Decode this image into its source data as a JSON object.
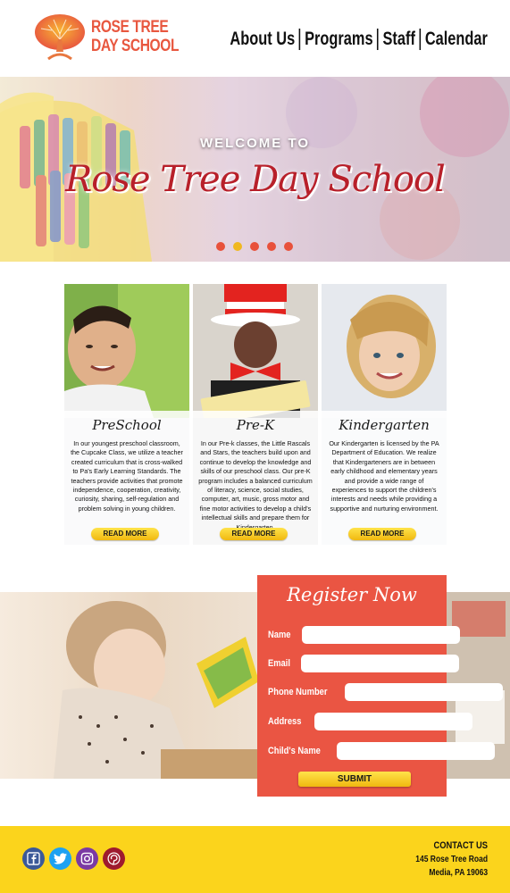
{
  "brand": {
    "line1": "ROSE TREE",
    "line2": "DAY SCHOOL",
    "color": "#e8573f"
  },
  "nav": {
    "items": [
      "About Us",
      "Programs",
      "Staff",
      "Calendar"
    ]
  },
  "hero": {
    "welcome": "WELCOME TO",
    "title": "Rose Tree Day School",
    "slides": 5,
    "active_slide": 2
  },
  "programs": [
    {
      "title": "PreSchool",
      "body": "In our youngest preschool classroom, the Cupcake Class, we utilize a teacher created curriculum that is cross-walked to Pa's Early Learning Standards. The teachers provide activities that promote independence, cooperation, creativity, curiosity, sharing, self-regulation and problem solving in young children.",
      "button": "READ MORE"
    },
    {
      "title": "Pre-K",
      "body": "In our Pre-k classes, the Little Rascals and Stars, the teachers build upon and continue to develop the knowledge and skills of our preschool class. Our pre-K program includes a balanced curriculum of literacy, science, social studies, computer, art, music, gross motor and fine motor activities to develop a child's intellectual skills and prepare them for Kindergarten.",
      "button": "READ MORE"
    },
    {
      "title": "Kindergarten",
      "body": "Our Kindergarten is licensed by the PA Department of Education. We realize that Kindergarteners are in between early childhood and elementary years and provide a wide range of experiences to support the children's interests and needs while providing a supportive and nurturing environment.",
      "button": "READ MORE"
    }
  ],
  "register": {
    "title": "Register Now",
    "fields": [
      "Name",
      "Email",
      "Phone Number",
      "Address",
      "Child's Name"
    ],
    "submit": "SUBMIT",
    "color": "#ea5543"
  },
  "footer": {
    "contact_heading": "CONTACT US",
    "address_line1": "145 Rose Tree Road",
    "address_line2": "Media, PA 19063",
    "color": "#fbd41c",
    "socials": [
      {
        "icon": "facebook-icon",
        "color": "#3b5998"
      },
      {
        "icon": "twitter-icon",
        "color": "#1da1f2"
      },
      {
        "icon": "instagram-icon",
        "color": "#7b3aa3"
      },
      {
        "icon": "pinterest-icon",
        "color": "#9e1b2e"
      }
    ]
  }
}
